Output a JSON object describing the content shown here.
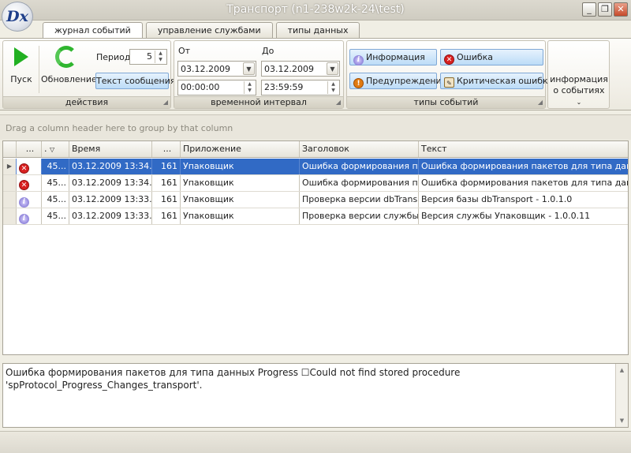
{
  "window": {
    "logo_text": "Dx",
    "title": "Транспорт (n1-238w2k-24\\test)",
    "minimize": "_",
    "restore": "❐",
    "close": "✕"
  },
  "tabs": [
    {
      "label": "журнал событий",
      "active": true
    },
    {
      "label": "управление службами",
      "active": false
    },
    {
      "label": "типы данных",
      "active": false
    }
  ],
  "ribbon": {
    "actions": {
      "caption": "действия",
      "start_label": "Пуск",
      "refresh_label": "Обновление",
      "period_label": "Период",
      "period_value": "5",
      "message_text_label": "Текст сообщения"
    },
    "interval": {
      "caption": "временной интервал",
      "from_label": "От",
      "to_label": "До",
      "from_date": "03.12.2009",
      "from_time": "00:00:00",
      "to_date": "03.12.2009",
      "to_time": "23:59:59"
    },
    "event_types": {
      "caption": "типы событий",
      "info": "Информация",
      "error": "Ошибка",
      "warning": "Предупреждение",
      "critical": "Критическая ошибка"
    },
    "event_info": {
      "line1": "информация",
      "line2": "о событиях"
    }
  },
  "group_panel_hint": "Drag a column header here to group by that column",
  "grid": {
    "columns": [
      "...",
      ".",
      "Время",
      "...",
      "Приложение",
      "Заголовок",
      "Текст"
    ],
    "rows": [
      {
        "type": "error",
        "id": "45...",
        "time": "03.12.2009 13:34...",
        "code": "161",
        "app": "Упаковщик",
        "header": "Ошибка формирования па...",
        "text": "Ошибка формирования пакетов для типа данных P",
        "selected": true
      },
      {
        "type": "error",
        "id": "45...",
        "time": "03.12.2009 13:34...",
        "code": "161",
        "app": "Упаковщик",
        "header": "Ошибка формирования па...",
        "text": "Ошибка формирования пакетов для типа данных P",
        "selected": false
      },
      {
        "type": "info",
        "id": "45...",
        "time": "03.12.2009 13:33...",
        "code": "161",
        "app": "Упаковщик",
        "header": "Проверка версии dbTrans...",
        "text": "Версия базы dbTransport - 1.0.1.0",
        "selected": false
      },
      {
        "type": "info",
        "id": "45...",
        "time": "03.12.2009 13:33...",
        "code": "161",
        "app": "Упаковщик",
        "header": "Проверка версии службы",
        "text": "Версия службы Упаковщик - 1.0.0.11",
        "selected": false
      }
    ]
  },
  "details": {
    "text": "Ошибка формирования пакетов для типа данных Progress ☐Could not find stored procedure 'spProtocol_Progress_Changes_transport'."
  },
  "icons": {
    "start": "play-icon",
    "refresh": "refresh-icon",
    "info": "info-icon",
    "error": "error-icon",
    "warning": "warning-icon",
    "critical": "critical-icon"
  }
}
